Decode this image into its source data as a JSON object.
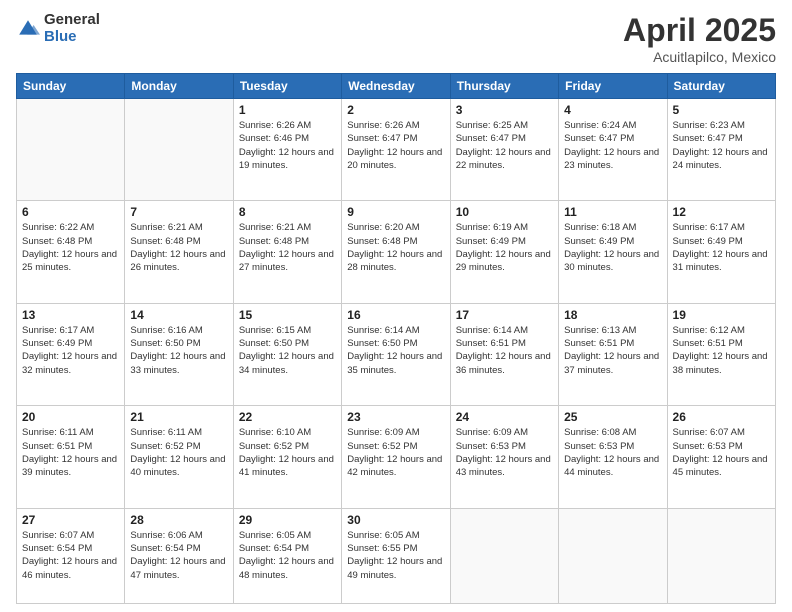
{
  "header": {
    "logo": {
      "general": "General",
      "blue": "Blue"
    },
    "title": "April 2025",
    "location": "Acuitlapilco, Mexico"
  },
  "weekdays": [
    "Sunday",
    "Monday",
    "Tuesday",
    "Wednesday",
    "Thursday",
    "Friday",
    "Saturday"
  ],
  "weeks": [
    [
      {
        "day": "",
        "info": ""
      },
      {
        "day": "",
        "info": ""
      },
      {
        "day": "1",
        "info": "Sunrise: 6:26 AM\nSunset: 6:46 PM\nDaylight: 12 hours and 19 minutes."
      },
      {
        "day": "2",
        "info": "Sunrise: 6:26 AM\nSunset: 6:47 PM\nDaylight: 12 hours and 20 minutes."
      },
      {
        "day": "3",
        "info": "Sunrise: 6:25 AM\nSunset: 6:47 PM\nDaylight: 12 hours and 22 minutes."
      },
      {
        "day": "4",
        "info": "Sunrise: 6:24 AM\nSunset: 6:47 PM\nDaylight: 12 hours and 23 minutes."
      },
      {
        "day": "5",
        "info": "Sunrise: 6:23 AM\nSunset: 6:47 PM\nDaylight: 12 hours and 24 minutes."
      }
    ],
    [
      {
        "day": "6",
        "info": "Sunrise: 6:22 AM\nSunset: 6:48 PM\nDaylight: 12 hours and 25 minutes."
      },
      {
        "day": "7",
        "info": "Sunrise: 6:21 AM\nSunset: 6:48 PM\nDaylight: 12 hours and 26 minutes."
      },
      {
        "day": "8",
        "info": "Sunrise: 6:21 AM\nSunset: 6:48 PM\nDaylight: 12 hours and 27 minutes."
      },
      {
        "day": "9",
        "info": "Sunrise: 6:20 AM\nSunset: 6:48 PM\nDaylight: 12 hours and 28 minutes."
      },
      {
        "day": "10",
        "info": "Sunrise: 6:19 AM\nSunset: 6:49 PM\nDaylight: 12 hours and 29 minutes."
      },
      {
        "day": "11",
        "info": "Sunrise: 6:18 AM\nSunset: 6:49 PM\nDaylight: 12 hours and 30 minutes."
      },
      {
        "day": "12",
        "info": "Sunrise: 6:17 AM\nSunset: 6:49 PM\nDaylight: 12 hours and 31 minutes."
      }
    ],
    [
      {
        "day": "13",
        "info": "Sunrise: 6:17 AM\nSunset: 6:49 PM\nDaylight: 12 hours and 32 minutes."
      },
      {
        "day": "14",
        "info": "Sunrise: 6:16 AM\nSunset: 6:50 PM\nDaylight: 12 hours and 33 minutes."
      },
      {
        "day": "15",
        "info": "Sunrise: 6:15 AM\nSunset: 6:50 PM\nDaylight: 12 hours and 34 minutes."
      },
      {
        "day": "16",
        "info": "Sunrise: 6:14 AM\nSunset: 6:50 PM\nDaylight: 12 hours and 35 minutes."
      },
      {
        "day": "17",
        "info": "Sunrise: 6:14 AM\nSunset: 6:51 PM\nDaylight: 12 hours and 36 minutes."
      },
      {
        "day": "18",
        "info": "Sunrise: 6:13 AM\nSunset: 6:51 PM\nDaylight: 12 hours and 37 minutes."
      },
      {
        "day": "19",
        "info": "Sunrise: 6:12 AM\nSunset: 6:51 PM\nDaylight: 12 hours and 38 minutes."
      }
    ],
    [
      {
        "day": "20",
        "info": "Sunrise: 6:11 AM\nSunset: 6:51 PM\nDaylight: 12 hours and 39 minutes."
      },
      {
        "day": "21",
        "info": "Sunrise: 6:11 AM\nSunset: 6:52 PM\nDaylight: 12 hours and 40 minutes."
      },
      {
        "day": "22",
        "info": "Sunrise: 6:10 AM\nSunset: 6:52 PM\nDaylight: 12 hours and 41 minutes."
      },
      {
        "day": "23",
        "info": "Sunrise: 6:09 AM\nSunset: 6:52 PM\nDaylight: 12 hours and 42 minutes."
      },
      {
        "day": "24",
        "info": "Sunrise: 6:09 AM\nSunset: 6:53 PM\nDaylight: 12 hours and 43 minutes."
      },
      {
        "day": "25",
        "info": "Sunrise: 6:08 AM\nSunset: 6:53 PM\nDaylight: 12 hours and 44 minutes."
      },
      {
        "day": "26",
        "info": "Sunrise: 6:07 AM\nSunset: 6:53 PM\nDaylight: 12 hours and 45 minutes."
      }
    ],
    [
      {
        "day": "27",
        "info": "Sunrise: 6:07 AM\nSunset: 6:54 PM\nDaylight: 12 hours and 46 minutes."
      },
      {
        "day": "28",
        "info": "Sunrise: 6:06 AM\nSunset: 6:54 PM\nDaylight: 12 hours and 47 minutes."
      },
      {
        "day": "29",
        "info": "Sunrise: 6:05 AM\nSunset: 6:54 PM\nDaylight: 12 hours and 48 minutes."
      },
      {
        "day": "30",
        "info": "Sunrise: 6:05 AM\nSunset: 6:55 PM\nDaylight: 12 hours and 49 minutes."
      },
      {
        "day": "",
        "info": ""
      },
      {
        "day": "",
        "info": ""
      },
      {
        "day": "",
        "info": ""
      }
    ]
  ]
}
